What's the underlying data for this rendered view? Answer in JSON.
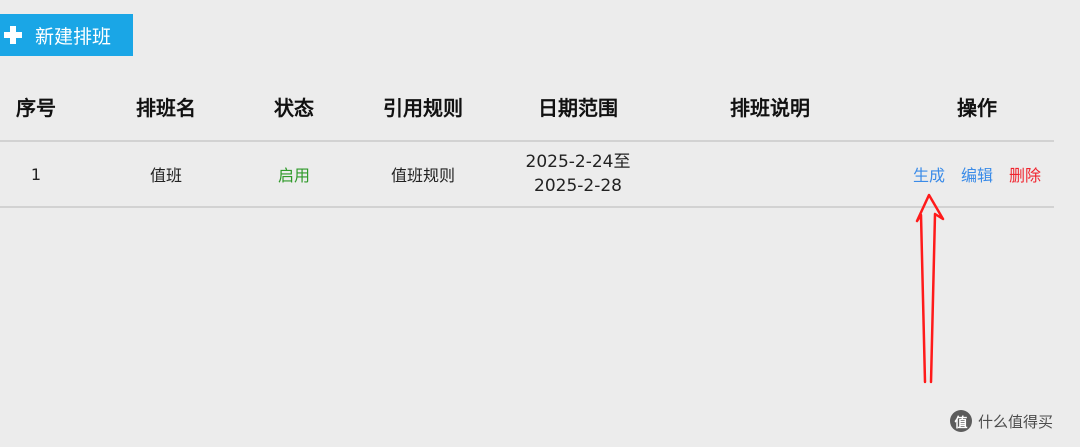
{
  "toolbar": {
    "add_label": "新建排班"
  },
  "table": {
    "headers": [
      "序号",
      "排班名",
      "状态",
      "引用规则",
      "日期范围",
      "排班说明",
      "操作"
    ],
    "rows": [
      {
        "index": "1",
        "name": "值班",
        "status": "启用",
        "rule": "值班规则",
        "date_start": "2025-2-24至",
        "date_end": "2025-2-28",
        "description": "",
        "actions": {
          "generate": "生成",
          "edit": "编辑",
          "delete": "删除"
        }
      }
    ]
  },
  "colors": {
    "accent": "#1aa6e6",
    "status_on": "#2f9a2a",
    "link": "#3a8be8",
    "danger": "#f0242e",
    "annotation": "#ff0000"
  },
  "watermark": {
    "text": "什么值得买"
  }
}
